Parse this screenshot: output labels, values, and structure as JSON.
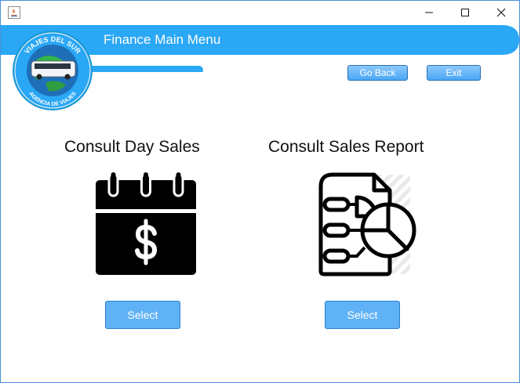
{
  "window": {
    "app_icon": "java-icon",
    "controls": [
      "minimize-icon",
      "maximize-icon",
      "close-icon"
    ]
  },
  "header": {
    "title": "Finance Main Menu",
    "logo": {
      "top_text": "VIAJES DEL SUR",
      "bottom_text": "AGENCIA DE VIAJES"
    }
  },
  "nav": {
    "go_back_label": "Go Back",
    "exit_label": "Exit"
  },
  "options": [
    {
      "title": "Consult Day Sales",
      "icon": "calendar-dollar-icon",
      "button_label": "Select"
    },
    {
      "title": "Consult Sales Report",
      "icon": "report-pie-chart-icon",
      "button_label": "Select"
    }
  ],
  "colors": {
    "banner": "#2aa7f5",
    "button": "#5fb2f5",
    "border": "#4a90d9"
  }
}
